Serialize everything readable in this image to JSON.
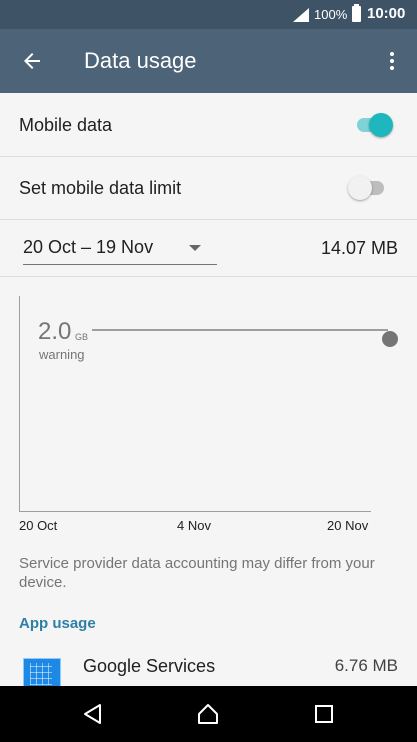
{
  "status_bar": {
    "battery_percent": "100%",
    "time": "10:00",
    "icons": [
      "signal-icon",
      "battery-icon"
    ]
  },
  "app_bar": {
    "title": "Data usage",
    "icons": [
      "back-arrow-icon",
      "overflow-menu-icon"
    ]
  },
  "settings": {
    "mobile_data": {
      "label": "Mobile data",
      "enabled": true
    },
    "data_limit": {
      "label": "Set mobile data limit",
      "enabled": false
    }
  },
  "cycle": {
    "selected": "20 Oct – 19 Nov",
    "total_usage": "14.07 MB"
  },
  "chart": {
    "warning_value": "2.0",
    "warning_unit": "GB",
    "warning_label": "warning",
    "x_ticks": [
      "20 Oct",
      "4 Nov",
      "20 Nov"
    ]
  },
  "note": "Service provider data accounting may differ from your device.",
  "app_usage": {
    "heading": "App usage",
    "apps": [
      {
        "name": "Google Services",
        "usage": "6.76 MB",
        "icon": "google-services-icon"
      }
    ]
  },
  "colors": {
    "status_bar": "#3e5366",
    "app_bar": "#4d6478",
    "accent": "#1fb7be",
    "section_heading": "#2e7fa6"
  },
  "nav_bar": {
    "icons": [
      "back-triangle-icon",
      "home-circle-icon",
      "recents-square-icon"
    ]
  }
}
